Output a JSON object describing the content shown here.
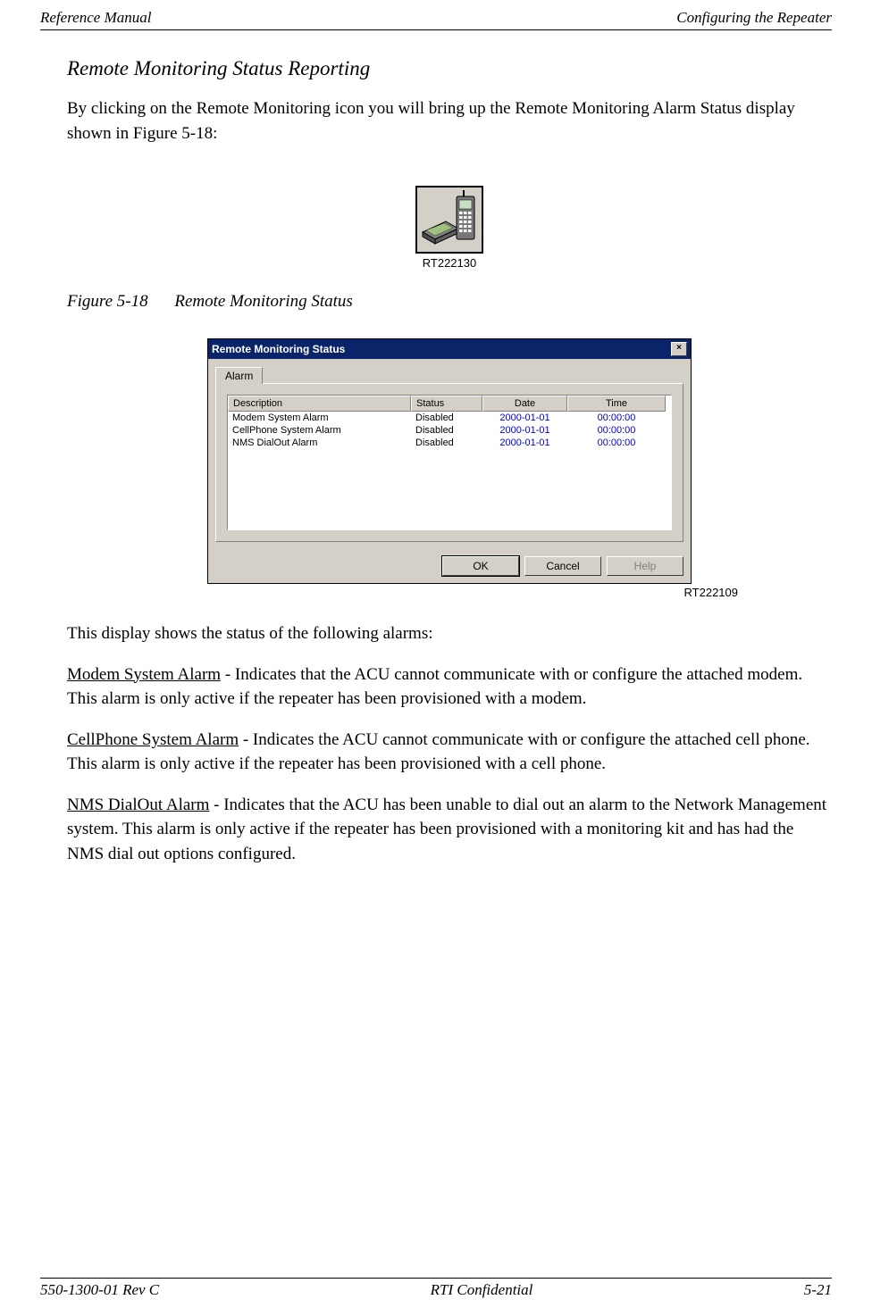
{
  "header": {
    "left": "Reference Manual",
    "right": "Configuring the Repeater"
  },
  "section_title": "Remote Monitoring Status Reporting",
  "intro_text": "By clicking on the Remote Monitoring icon you will bring up the Remote Monitoring Alarm Status display shown in Figure 5-18:",
  "icon_figure_id": "RT222130",
  "figure_caption": {
    "num": "Figure 5-18",
    "title": "Remote Monitoring Status"
  },
  "dialog": {
    "title": "Remote Monitoring Status",
    "tab": "Alarm",
    "columns": {
      "desc": "Description",
      "status": "Status",
      "date": "Date",
      "time": "Time"
    },
    "rows": [
      {
        "desc": "Modem System Alarm",
        "status": "Disabled",
        "date": "2000-01-01",
        "time": "00:00:00"
      },
      {
        "desc": "CellPhone System Alarm",
        "status": "Disabled",
        "date": "2000-01-01",
        "time": "00:00:00"
      },
      {
        "desc": "NMS DialOut Alarm",
        "status": "Disabled",
        "date": "2000-01-01",
        "time": "00:00:00"
      }
    ],
    "buttons": {
      "ok": "OK",
      "cancel": "Cancel",
      "help": "Help"
    },
    "figure_id": "RT222109"
  },
  "after_dialog_intro": "This display shows the status of the following alarms:",
  "alarms": [
    {
      "name": "Modem System Alarm",
      "text": " - Indicates that the ACU cannot communicate with or configure the attached modem. This alarm is only active if the repeater has been provisioned with a modem."
    },
    {
      "name": "CellPhone System Alarm",
      "text": " - Indicates the ACU cannot communicate with or configure the attached cell phone. This alarm is only active if the repeater has been provisioned with a cell phone."
    },
    {
      "name": "NMS DialOut Alarm",
      "text": " - Indicates that the ACU has been unable to dial out an alarm to the Network Management system. This alarm is only active if the repeater has been provisioned with a monitoring kit and has had the NMS dial out options configured."
    }
  ],
  "footer": {
    "left": "550-1300-01 Rev C",
    "center": "RTI Confidential",
    "right": "5-21"
  }
}
